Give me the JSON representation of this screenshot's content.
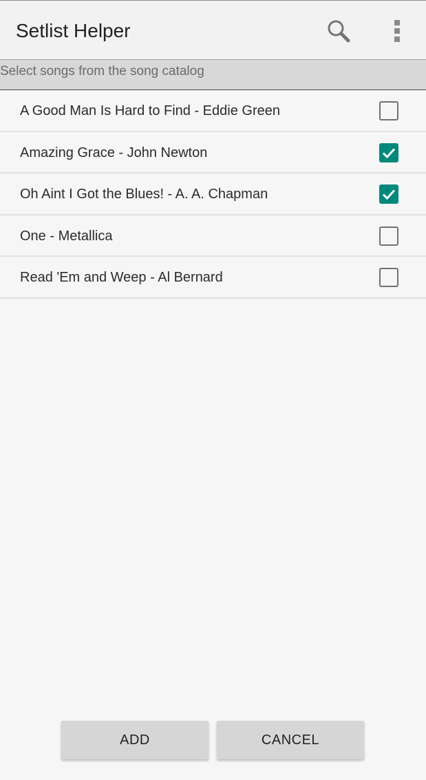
{
  "app_bar": {
    "title": "Setlist Helper",
    "search_icon": "search-icon",
    "overflow_icon": "more-vert-icon"
  },
  "subheader": {
    "text": "Select songs from the song catalog"
  },
  "songs": [
    {
      "label": "A Good Man Is Hard to Find - Eddie Green",
      "checked": false
    },
    {
      "label": "Amazing Grace - John Newton",
      "checked": true
    },
    {
      "label": "Oh Aint I Got the Blues! - A. A. Chapman",
      "checked": true
    },
    {
      "label": "One - Metallica",
      "checked": false
    },
    {
      "label": "Read 'Em and Weep - Al Bernard",
      "checked": false
    }
  ],
  "actions": {
    "add_label": "ADD",
    "cancel_label": "CANCEL"
  },
  "colors": {
    "accent": "#00897b",
    "background": "#f6f6f6",
    "subheader_bg": "#d8d8d8"
  }
}
